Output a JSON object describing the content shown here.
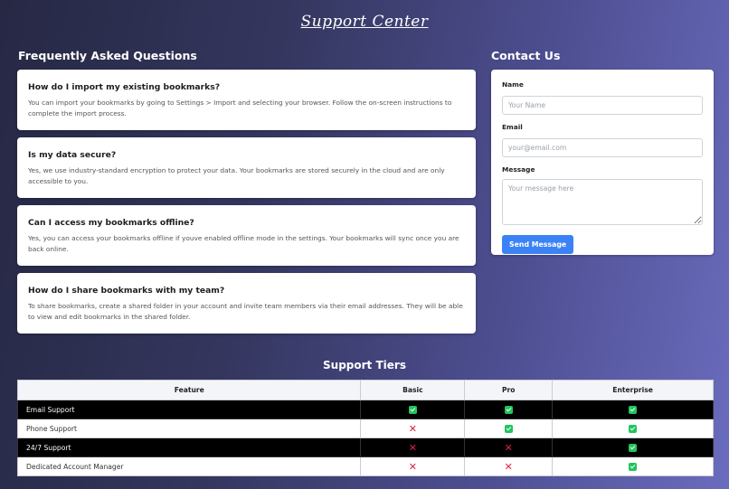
{
  "page": {
    "title": "Support Center"
  },
  "faq": {
    "heading": "Frequently Asked Questions",
    "items": [
      {
        "question": "How do I import my existing bookmarks?",
        "answer": "You can import your bookmarks by going to Settings > Import and selecting your browser. Follow the on-screen instructions to complete the import process."
      },
      {
        "question": "Is my data secure?",
        "answer": "Yes, we use industry-standard encryption to protect your data. Your bookmarks are stored securely in the cloud and are only accessible to you."
      },
      {
        "question": "Can I access my bookmarks offline?",
        "answer": "Yes, you can access your bookmarks offline if youve enabled offline mode in the settings. Your bookmarks will sync once you are back online."
      },
      {
        "question": "How do I share bookmarks with my team?",
        "answer": "To share bookmarks, create a shared folder in your account and invite team members via their email addresses. They will be able to view and edit bookmarks in the shared folder."
      }
    ]
  },
  "contact": {
    "heading": "Contact Us",
    "name_label": "Name",
    "name_placeholder": "Your Name",
    "email_label": "Email",
    "email_placeholder": "your@email.com",
    "message_label": "Message",
    "message_placeholder": "Your message here",
    "send_label": "Send Message",
    "button_color": "#3b82f6"
  },
  "tiers": {
    "heading": "Support Tiers",
    "columns": [
      "Feature",
      "Basic",
      "Pro",
      "Enterprise"
    ],
    "rows": [
      {
        "feature": "Email Support",
        "basic": "check",
        "pro": "check",
        "enterprise": "check"
      },
      {
        "feature": "Phone Support",
        "basic": "cross",
        "pro": "check",
        "enterprise": "check"
      },
      {
        "feature": "24/7 Support",
        "basic": "cross",
        "pro": "cross",
        "enterprise": "check"
      },
      {
        "feature": "Dedicated Account Manager",
        "basic": "cross",
        "pro": "cross",
        "enterprise": "check"
      }
    ],
    "check_color": "#22c55e",
    "cross_color": "#e11d48"
  }
}
